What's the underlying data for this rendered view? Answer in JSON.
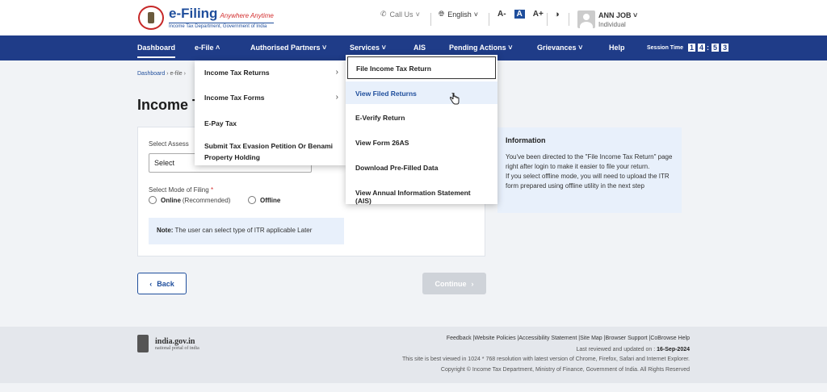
{
  "header": {
    "logo_title": "e-Filing",
    "logo_tagline": "Anywhere Anytime",
    "logo_sub": "Income Tax Department, Government of India",
    "call_us": "Call Us",
    "language": "English",
    "font_small": "A-",
    "font_normal": "A",
    "font_large": "A+",
    "user_name": "ANN JOB",
    "user_role": "Individual"
  },
  "nav": {
    "dashboard": "Dashboard",
    "efile": "e-File",
    "authorised_partners": "Authorised Partners",
    "services": "Services",
    "ais": "AIS",
    "pending_actions": "Pending Actions",
    "grievances": "Grievances",
    "help": "Help",
    "session_label": "Session Time",
    "session_digits": [
      "1",
      "4",
      ":",
      "5",
      "3"
    ]
  },
  "breadcrumb": {
    "dashboard": "Dashboard",
    "efile": "e-file"
  },
  "page": {
    "title": "Income T"
  },
  "form": {
    "assessment_label": "Select Assess",
    "select_placeholder": "Select",
    "mode_label": "Select Mode of Filing",
    "required_mark": "*",
    "online_label": "Online",
    "online_hint": "(Recommended)",
    "offline_label": "Offline",
    "note_label": "Note:",
    "note_text": "The user can select type of ITR applicable Later"
  },
  "info": {
    "title": "Information",
    "line1": "You've been directed to the \"File Income Tax Return\" page right after login to make it easier to file your return.",
    "line2": "If you select offline mode, you will need to upload the ITR form prepared using offline utility in the next step"
  },
  "buttons": {
    "back": "Back",
    "continue": "Continue"
  },
  "efile_menu": {
    "items": [
      "Income Tax Returns",
      "Income Tax Forms",
      "E-Pay Tax",
      "Submit Tax Evasion Petition Or Benami",
      "Property Holding"
    ]
  },
  "services_menu": {
    "items": [
      "File Income Tax Return",
      "View Filed Returns",
      "E-Verify Return",
      "View Form 26AS",
      "Download Pre-Filled Data",
      "View Annual Information Statement (AIS)"
    ]
  },
  "footer": {
    "india_name": "india.gov.in",
    "india_sub": "national portal of india",
    "links": "Feedback |Website Policies |Accessibility Statement |Site Map |Browser Support |CoBrowse Help",
    "reviewed_label": "Last reviewed and updated on :",
    "reviewed_date": "16-Sep-2024",
    "best_viewed": "This site is best viewed in 1024 * 768 resolution with latest version of Chrome, Firefox, Safari and Internet Explorer.",
    "copyright": "Copyright © Income Tax Department, Ministry of Finance, Government of India. All Rights Reserved"
  },
  "colors": {
    "nav_bg": "#1f3c88",
    "accent": "#1f4e9c",
    "page_bg": "#f1f3f6",
    "info_bg": "#e8f0fb"
  }
}
